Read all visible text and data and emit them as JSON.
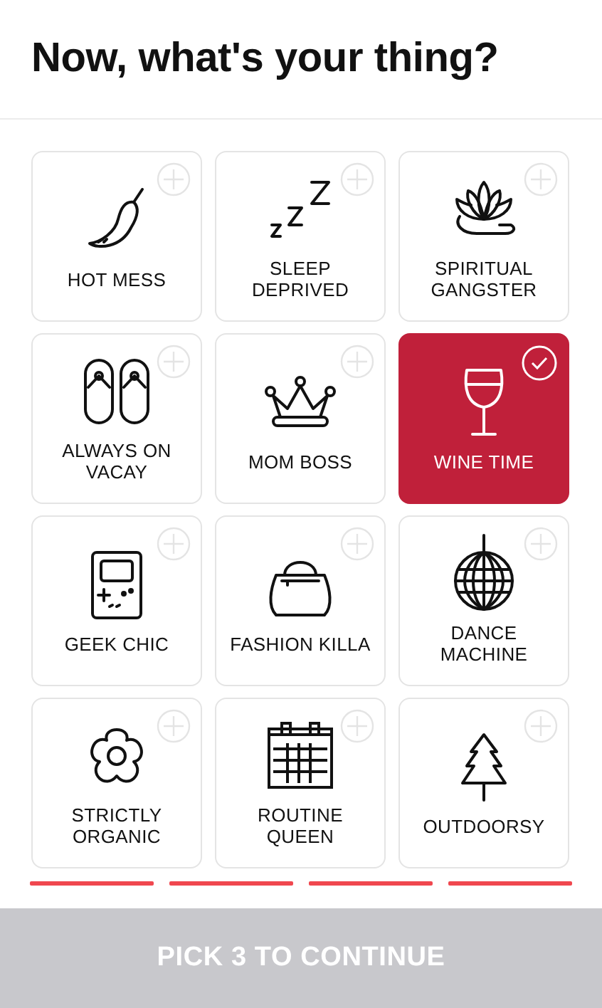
{
  "header": {
    "title": "Now, what's your thing?"
  },
  "options": [
    {
      "label": "HOT MESS",
      "selected": false
    },
    {
      "label": "SLEEP DEPRIVED",
      "selected": false
    },
    {
      "label": "SPIRITUAL GANGSTER",
      "selected": false
    },
    {
      "label": "ALWAYS ON VACAY",
      "selected": false
    },
    {
      "label": "MOM BOSS",
      "selected": false
    },
    {
      "label": "WINE TIME",
      "selected": true
    },
    {
      "label": "GEEK CHIC",
      "selected": false
    },
    {
      "label": "FASHION KILLA",
      "selected": false
    },
    {
      "label": "DANCE MACHINE",
      "selected": false
    },
    {
      "label": "STRICTLY ORGANIC",
      "selected": false
    },
    {
      "label": "ROUTINE QUEEN",
      "selected": false
    },
    {
      "label": "OUTDOORSY",
      "selected": false
    }
  ],
  "continue_button": {
    "label": "PICK 3 TO CONTINUE",
    "disabled": true
  }
}
